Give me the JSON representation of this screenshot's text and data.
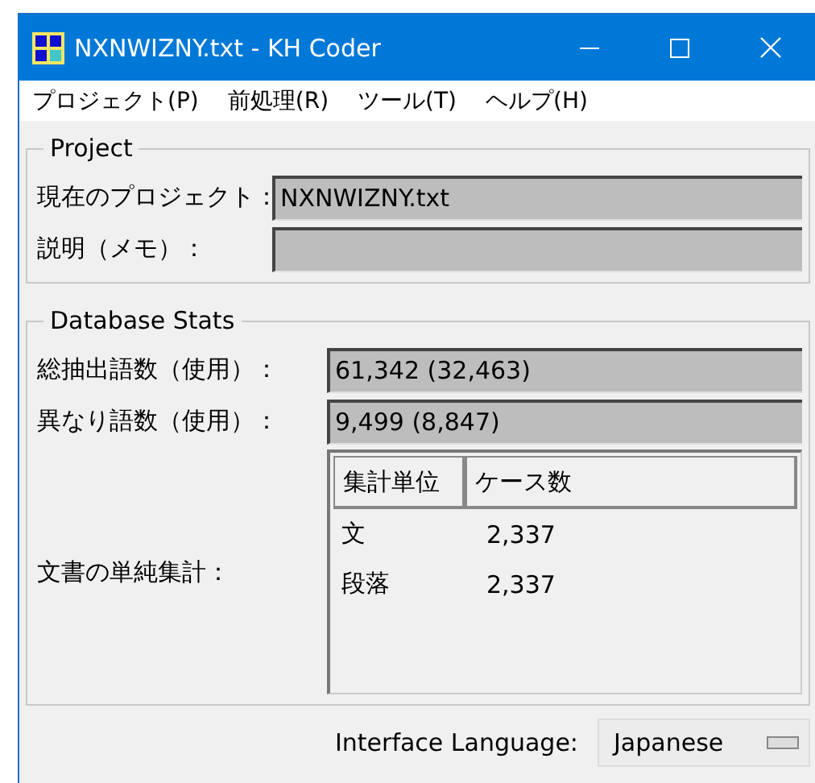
{
  "window": {
    "title": "NXNWIZNY.txt - KH Coder"
  },
  "menu": [
    "プロジェクト(P)",
    "前処理(R)",
    "ツール(T)",
    "ヘルプ(H)"
  ],
  "project": {
    "title": "Project",
    "fields": [
      {
        "label": "現在のプロジェクト：",
        "value": "NXNWIZNY.txt"
      },
      {
        "label": "説明（メモ）："
      }
    ]
  },
  "database_stats": {
    "title": "Database Stats",
    "fields": [
      {
        "label": "総抽出語数（使用）：",
        "value": "61,342 (32,463)"
      },
      {
        "label": "異なり語数（使用）：",
        "value": "9,499 (8,847)"
      }
    ],
    "table_label": "文書の単純集計：",
    "table": {
      "columns": [
        "集計単位",
        "ケース数"
      ],
      "rows": [
        [
          "文",
          "2,337"
        ],
        [
          "段落",
          "2,337"
        ]
      ]
    }
  },
  "interface_language": {
    "label": "Interface Language:",
    "value": "Japanese"
  }
}
